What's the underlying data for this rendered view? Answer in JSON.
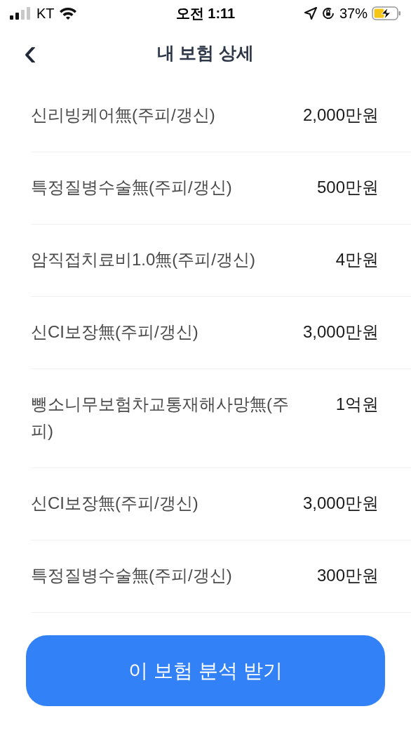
{
  "status_bar": {
    "carrier": "KT",
    "time": "오전 1:11",
    "battery": "37%"
  },
  "header": {
    "back": "‹",
    "title": "내 보험 상세"
  },
  "coverages": [
    {
      "name": "신리빙케어無(주피/갱신)",
      "amount": "2,000만원"
    },
    {
      "name": "특정질병수술無(주피/갱신)",
      "amount": "500만원"
    },
    {
      "name": "암직접치료비1.0無(주피/갱신)",
      "amount": "4만원"
    },
    {
      "name": "신CI보장無(주피/갱신)",
      "amount": "3,000만원"
    },
    {
      "name": "뺑소니무보험차교통재해사망無(주피)",
      "amount": "1억원"
    },
    {
      "name": "신CI보장無(주피/갱신)",
      "amount": "3,000만원"
    },
    {
      "name": "특정질병수술無(주피/갱신)",
      "amount": "300만원"
    }
  ],
  "button": {
    "label": "이 보험 분석 받기"
  }
}
